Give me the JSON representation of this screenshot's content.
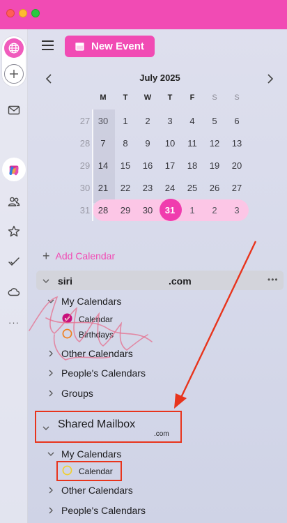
{
  "window": {
    "traffic_lights": [
      "close",
      "minimize",
      "zoom"
    ],
    "titlebar_color": "#f14bb4"
  },
  "sidebar_rail": {
    "items": [
      "globe-icon",
      "add-icon",
      "mail-icon",
      "calendar-icon",
      "copilot-icon",
      "people-icon",
      "star-icon",
      "todo-icon",
      "cloud-icon",
      "more-icon"
    ],
    "active": "calendar-icon",
    "more_label": "···"
  },
  "toolbar": {
    "new_event_label": "New Event"
  },
  "mini_calendar": {
    "month_label": "July 2025",
    "weekdays": [
      "M",
      "T",
      "W",
      "T",
      "F",
      "S",
      "S"
    ],
    "weeks": [
      {
        "week": "27",
        "days": [
          "30",
          "1",
          "2",
          "3",
          "4",
          "5",
          "6"
        ]
      },
      {
        "week": "28",
        "days": [
          "7",
          "8",
          "9",
          "10",
          "11",
          "12",
          "13"
        ]
      },
      {
        "week": "29",
        "days": [
          "14",
          "15",
          "16",
          "17",
          "18",
          "19",
          "20"
        ]
      },
      {
        "week": "30",
        "days": [
          "21",
          "22",
          "23",
          "24",
          "25",
          "26",
          "27"
        ]
      },
      {
        "week": "31",
        "days": [
          "28",
          "29",
          "30",
          "31",
          "1",
          "2",
          "3"
        ]
      }
    ],
    "today": "31"
  },
  "calendar_list": {
    "add_calendar_label": "Add Calendar",
    "account1": {
      "name": "siri",
      "domain": ".com",
      "groups": {
        "my_calendars": "My Calendars",
        "calendar": "Calendar",
        "birthdays": "Birthdays",
        "other_calendars": "Other Calendars",
        "peoples_calendars": "People's Calendars",
        "groups": "Groups"
      },
      "calendar_color": "#c8107d",
      "birthdays_color": "#f08020"
    },
    "account2": {
      "name": "Shared Mailbox",
      "domain": ".com",
      "groups": {
        "my_calendars": "My Calendars",
        "calendar": "Calendar",
        "other_calendars": "Other Calendars",
        "peoples_calendars": "People's Calendars"
      },
      "calendar_color": "#f0d030"
    }
  },
  "annotation_color": "#e8341c"
}
